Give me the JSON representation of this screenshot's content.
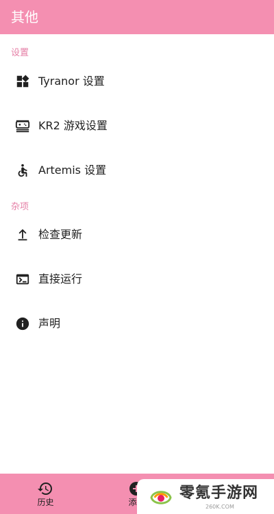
{
  "app_bar": {
    "title": "其他"
  },
  "sections": [
    {
      "header": "设置",
      "items": [
        {
          "label": "Tyranor 设置",
          "icon": "widgets-icon"
        },
        {
          "label": "KR2 游戏设置",
          "icon": "gamepad-icon"
        },
        {
          "label": "Artemis 设置",
          "icon": "accessible-icon"
        }
      ]
    },
    {
      "header": "杂项",
      "items": [
        {
          "label": "检查更新",
          "icon": "upload-icon"
        },
        {
          "label": "直接运行",
          "icon": "terminal-icon"
        },
        {
          "label": "声明",
          "icon": "info-icon"
        }
      ]
    }
  ],
  "bottom_nav": {
    "items": [
      {
        "label": "历史",
        "icon": "history-icon"
      },
      {
        "label": "添加",
        "icon": "add-icon"
      }
    ]
  },
  "watermark": {
    "text": "零氪手游网",
    "sub": "260K.COM"
  },
  "colors": {
    "primary": "#F48FB1",
    "section_header": "#E57FA6"
  }
}
